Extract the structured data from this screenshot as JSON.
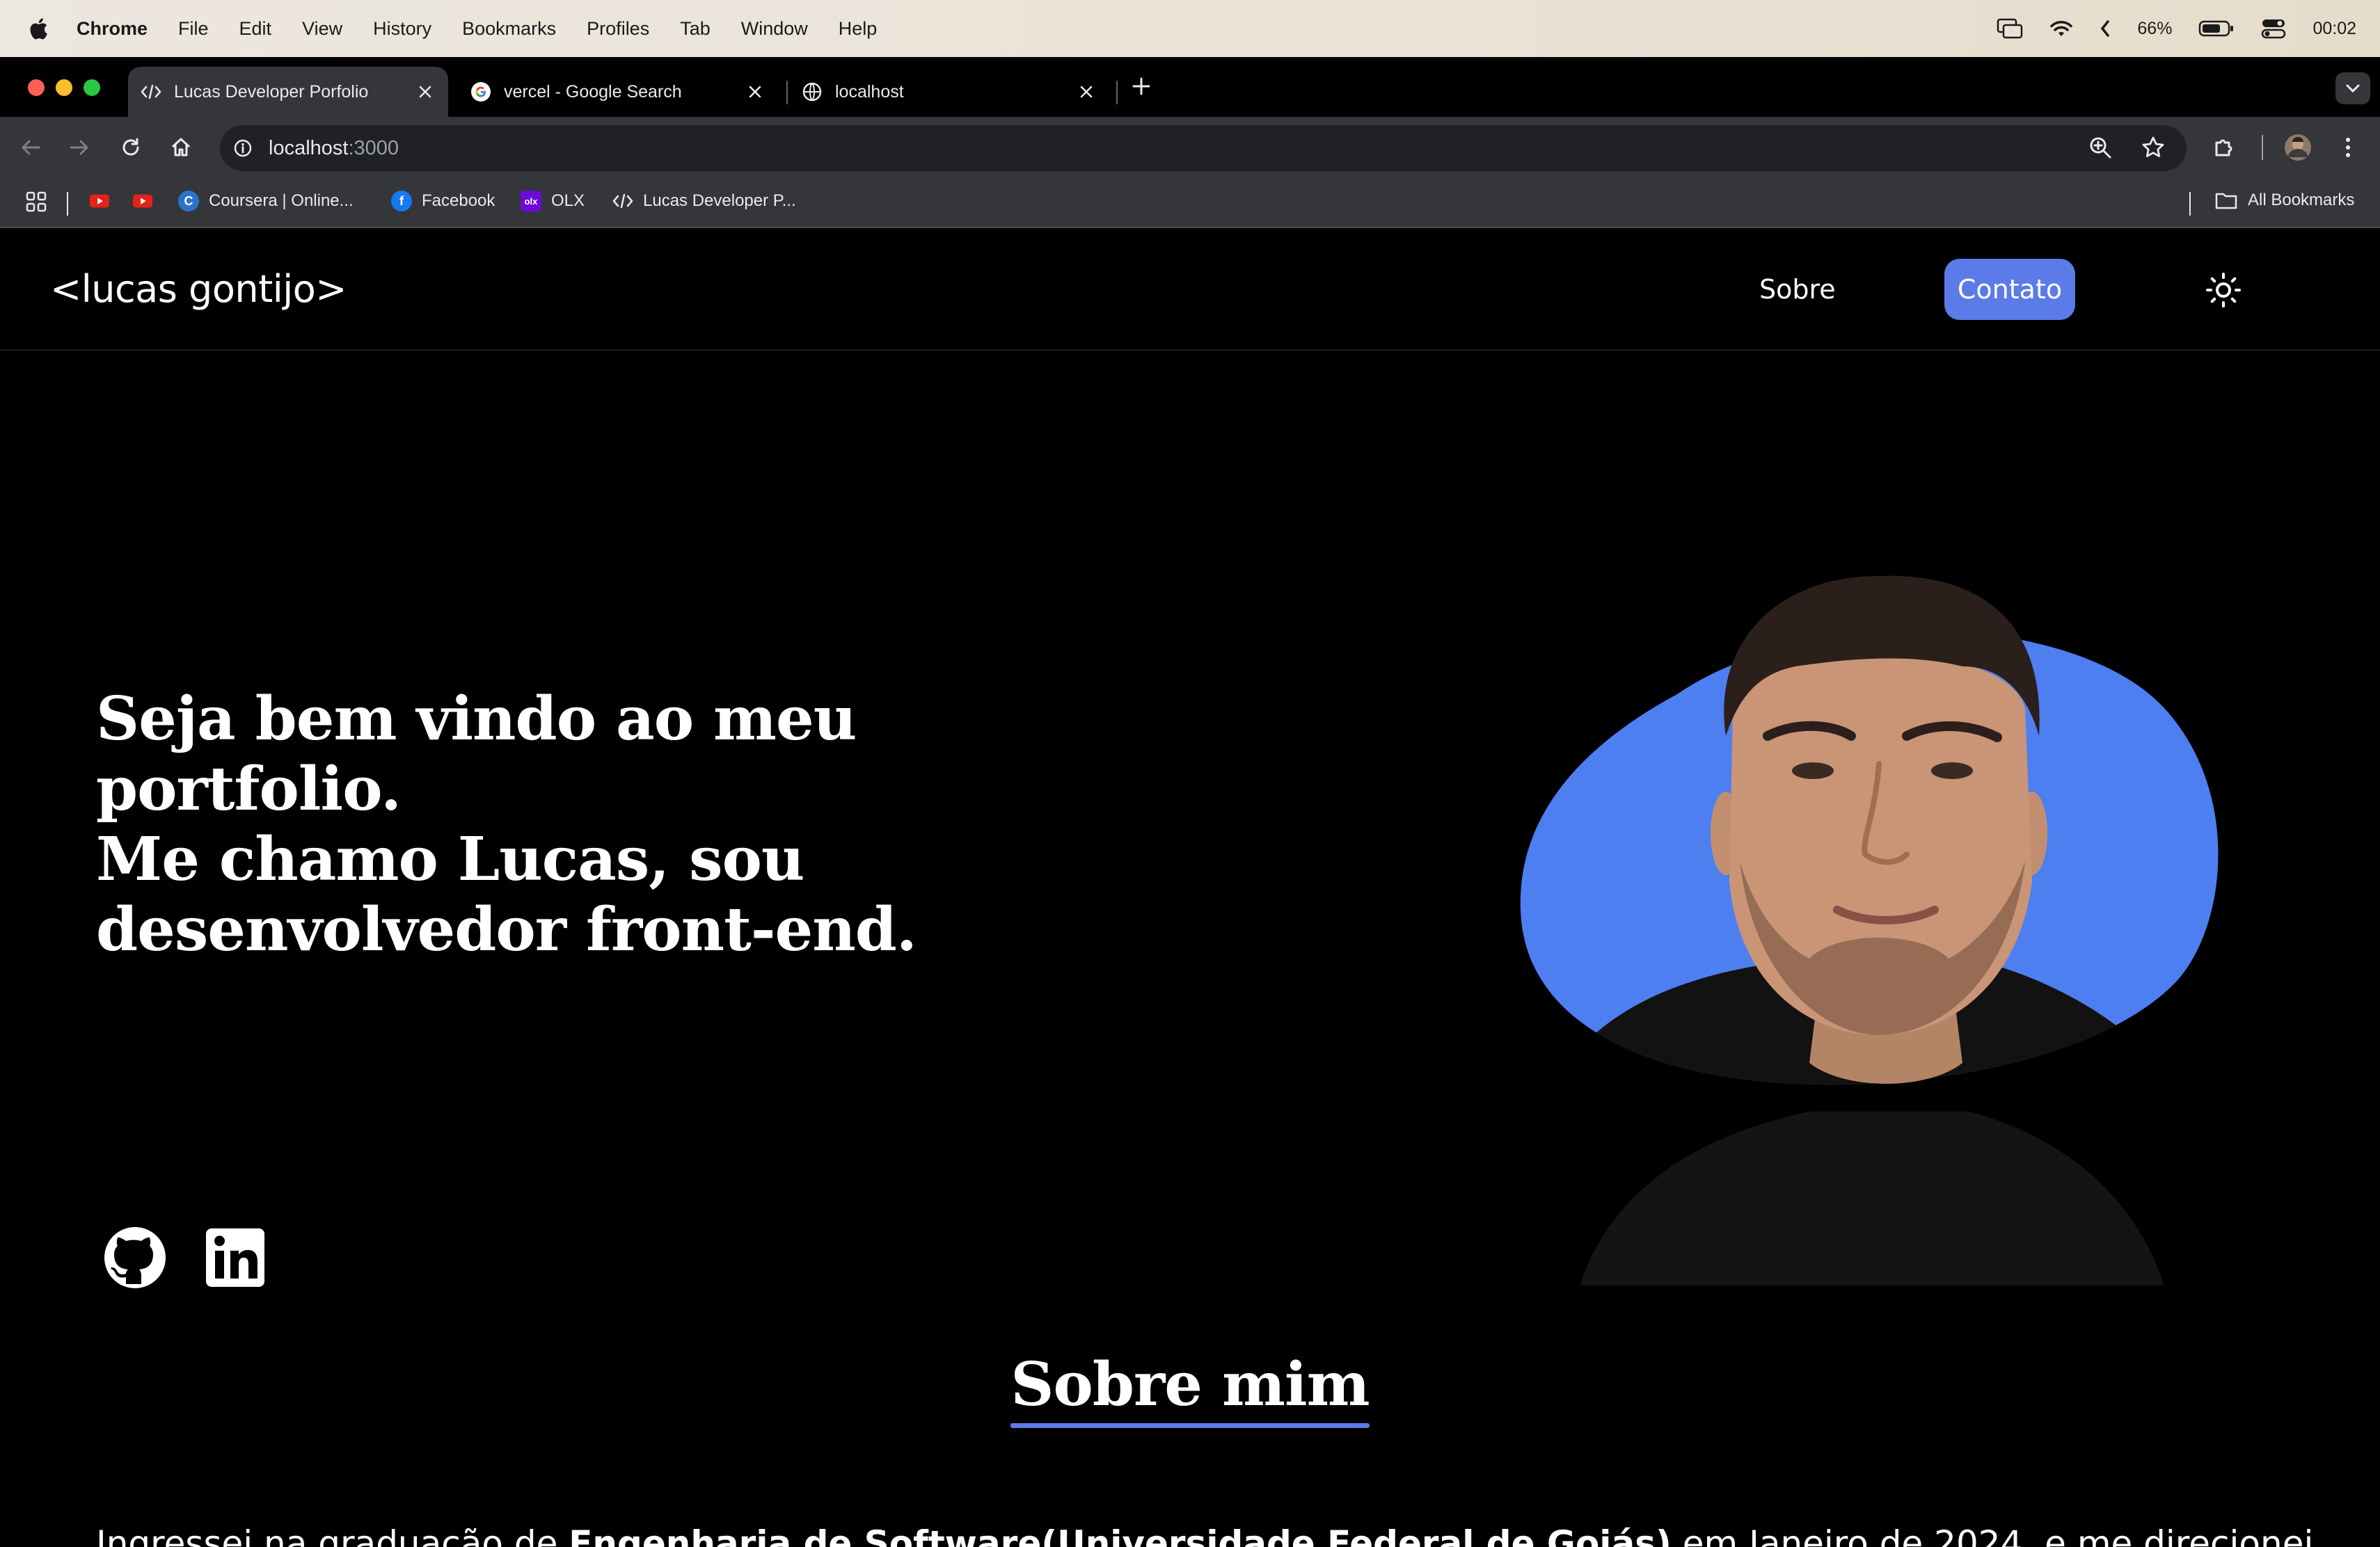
{
  "menubar": {
    "app_name": "Chrome",
    "items": [
      "File",
      "Edit",
      "View",
      "History",
      "Bookmarks",
      "Profiles",
      "Tab",
      "Window",
      "Help"
    ],
    "battery": "66%",
    "clock": "00:02"
  },
  "tabs": [
    {
      "title": "Lucas Developer Porfolio",
      "icon": "code-icon",
      "active": true
    },
    {
      "title": "vercel - Google Search",
      "icon": "google-icon",
      "active": false
    },
    {
      "title": "localhost",
      "icon": "globe-icon",
      "active": false
    }
  ],
  "omnibox": {
    "host": "localhost",
    "port": ":3000"
  },
  "bookmarks": {
    "items": [
      {
        "label": "",
        "icon": "youtube-icon"
      },
      {
        "label": "",
        "icon": "youtube-icon"
      },
      {
        "label": "Coursera | Online...",
        "icon": "coursera-icon"
      },
      {
        "label": "Facebook",
        "icon": "facebook-icon"
      },
      {
        "label": "OLX",
        "icon": "olx-icon"
      },
      {
        "label": "Lucas Developer P...",
        "icon": "code-icon"
      }
    ],
    "all_bookmarks": "All Bookmarks"
  },
  "site": {
    "logo": "<lucas gontijo>",
    "nav": {
      "sobre": "Sobre",
      "contato": "Contato"
    },
    "hero": {
      "line1": "Seja bem vindo ao meu portfolio.",
      "line2": "Me chamo Lucas, sou",
      "line3": "desenvolvedor front-end."
    },
    "section_title": "Sobre mim",
    "about": {
      "prefix": "Ingressei na graduação de ",
      "bold": "Engenharia de Software(Universidade Federal de Goiás)",
      "suffix": " em Janeiro de 2024, e me direcionei"
    },
    "colors": {
      "accent": "#5b7be8",
      "blob": "#4d7ff0",
      "background": "#000000"
    }
  }
}
